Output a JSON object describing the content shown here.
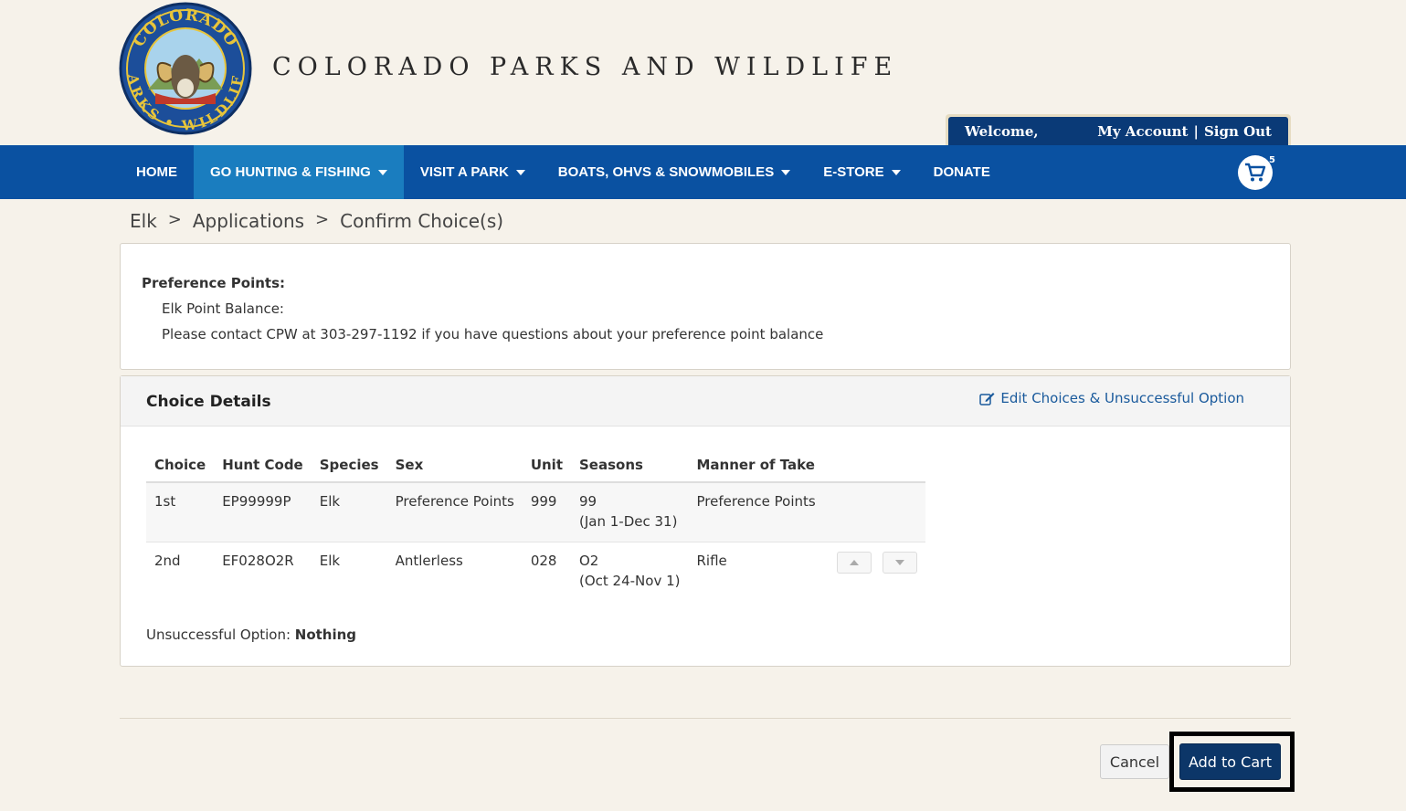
{
  "header": {
    "title": "COLORADO PARKS AND WILDLIFE",
    "logo_text_top": "COLORADO",
    "logo_text_bottom": "PARKS • WILDLIFE"
  },
  "account": {
    "welcome": "Welcome,",
    "my_account": "My Account",
    "separator": "|",
    "sign_out": "Sign Out"
  },
  "nav": {
    "items": [
      {
        "label": "HOME",
        "caret": false,
        "active": false
      },
      {
        "label": "GO HUNTING & FISHING",
        "caret": true,
        "active": true
      },
      {
        "label": "VISIT A PARK",
        "caret": true,
        "active": false
      },
      {
        "label": "BOATS, OHVS & SNOWMOBILES",
        "caret": true,
        "active": false
      },
      {
        "label": "E-STORE",
        "caret": true,
        "active": false
      },
      {
        "label": "DONATE",
        "caret": false,
        "active": false
      }
    ],
    "cart_count": "5",
    "cart_icon": "shopping-cart-icon"
  },
  "breadcrumb": {
    "items": [
      "Elk",
      "Applications",
      "Confirm Choice(s)"
    ],
    "separator": ">"
  },
  "preference": {
    "title": "Preference Points:",
    "balance_label": "Elk Point Balance:",
    "contact_note": "Please contact CPW at 303-297-1192 if you have questions about your preference point balance"
  },
  "choice_details": {
    "title": "Choice Details",
    "edit_label": "Edit Choices & Unsuccessful Option",
    "edit_icon": "edit-icon",
    "columns": [
      "Choice",
      "Hunt Code",
      "Species",
      "Sex",
      "Unit",
      "Seasons",
      "Manner of Take"
    ],
    "rows": [
      {
        "choice": "1st",
        "hunt_code": "EP99999P",
        "species": "Elk",
        "sex": "Preference Points",
        "unit": "999",
        "season": "99",
        "season_dates": "(Jan 1-Dec 31)",
        "manner": "Preference Points"
      },
      {
        "choice": "2nd",
        "hunt_code": "EF028O2R",
        "species": "Elk",
        "sex": "Antlerless",
        "unit": "028",
        "season": "O2",
        "season_dates": "(Oct 24-Nov 1)",
        "manner": "Rifle"
      }
    ],
    "unsuccessful_label": "Unsuccessful Option:",
    "unsuccessful_value": "Nothing"
  },
  "actions": {
    "cancel": "Cancel",
    "add_to_cart": "Add to Cart"
  },
  "colors": {
    "nav_bg": "#0a51a1",
    "nav_active": "#1a7dbf",
    "page_bg": "#f6f2ea",
    "primary_button": "#0c3668",
    "link": "#1a5a9c"
  }
}
